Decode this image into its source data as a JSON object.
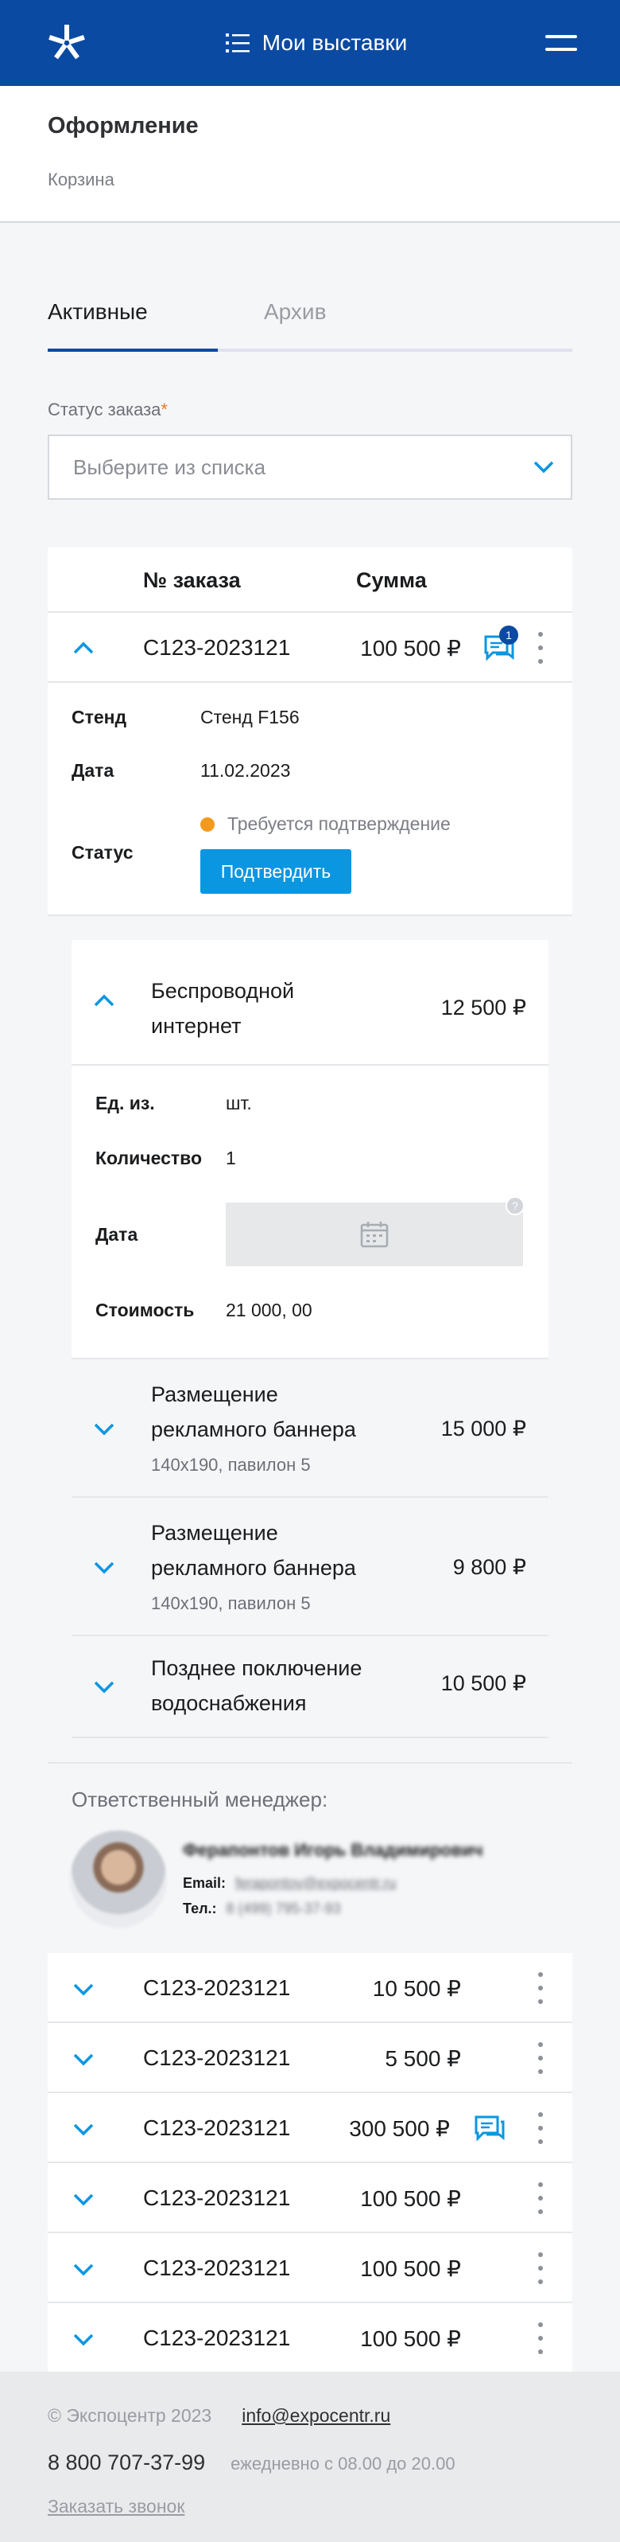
{
  "header": {
    "title": "Мои выставки"
  },
  "page": {
    "title": "Оформление",
    "breadcrumb": "Корзина"
  },
  "tabs": [
    {
      "label": "Активные"
    },
    {
      "label": "Архив"
    }
  ],
  "filter": {
    "label": "Статус заказа",
    "required_mark": "*",
    "placeholder": "Выберите из списка"
  },
  "table": {
    "col_number": "№ заказа",
    "col_sum": "Сумма",
    "expanded_order": {
      "number": "С123-2023121",
      "sum": "100 500 ₽",
      "messages_badge": "1",
      "details": {
        "stand_label": "Стенд",
        "stand_value": "Стенд F156",
        "date_label": "Дата",
        "date_value": "11.02.2023",
        "status_label": "Статус",
        "status_value": "Требуется подтверждение",
        "confirm_button": "Подтвердить"
      },
      "services": {
        "open": {
          "title": "Беспроводной интернет",
          "price": "12 500 ₽",
          "unit_label": "Ед. из.",
          "unit_value": "шт.",
          "qty_label": "Количество",
          "qty_value": "1",
          "date_label": "Дата",
          "cost_label": "Стоимость",
          "cost_value": "21 000, 00",
          "help": "?"
        },
        "items": [
          {
            "title": "Размещение рекламного баннера",
            "sub": "140х190, павилон 5",
            "price": "15 000 ₽"
          },
          {
            "title": "Размещение рекламного баннера",
            "sub": "140х190, павилон 5",
            "price": "9 800 ₽"
          },
          {
            "title": "Позднее поключение водоснабжения",
            "sub": "",
            "price": "10 500 ₽"
          }
        ]
      },
      "manager": {
        "title": "Ответственный менеджер:",
        "name": "Ферапонтов Игорь Владимирович",
        "email_label": "Email:",
        "email_value": "ferapontov@expocentr.ru",
        "phone_label": "Тел.:",
        "phone_value": "8 (499) 795-37-93"
      }
    },
    "orders": [
      {
        "number": "С123-2023121",
        "sum": "10 500 ₽"
      },
      {
        "number": "С123-2023121",
        "sum": "5 500 ₽"
      },
      {
        "number": "С123-2023121",
        "sum": "300 500 ₽"
      },
      {
        "number": "С123-2023121",
        "sum": "100 500 ₽"
      },
      {
        "number": "С123-2023121",
        "sum": "100 500 ₽"
      },
      {
        "number": "С123-2023121",
        "sum": "100 500 ₽"
      }
    ]
  },
  "footer": {
    "copyright": "© Экспоцентр 2023",
    "email": "info@expocentr.ru",
    "phone": "8 800 707-37-99",
    "hours": "ежедневно с 08.00 до 20.00",
    "callback": "Заказать звонок"
  },
  "colors": {
    "brand": "#0b4aa2",
    "accent": "#0a96e0",
    "status_pending": "#f39a1e"
  }
}
